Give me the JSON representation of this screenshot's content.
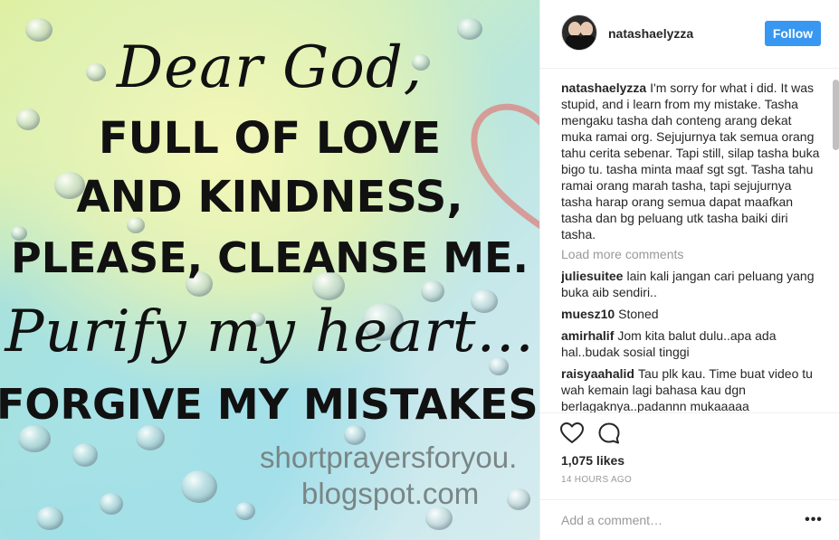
{
  "image": {
    "lines": [
      "Dear God,",
      "FULL OF LOVE",
      "AND KINDNESS,",
      "PLEASE,  CLEANSE ME.",
      "Purify my heart...",
      "FORGIVE MY MISTAKES..."
    ],
    "site_line1": "shortprayersforyou.",
    "site_line2": "blogspot.com"
  },
  "header": {
    "username": "natashaelyzza",
    "follow_label": "Follow"
  },
  "caption": {
    "user": "natashaelyzza",
    "text": "I'm sorry for what i did. It was stupid, and i learn from my mistake. Tasha mengaku tasha dah conteng arang dekat muka ramai org. Sejujurnya tak semua orang tahu cerita sebenar. Tapi still, silap tasha buka bigo tu. tasha minta maaf sgt sgt. Tasha tahu ramai orang marah tasha, tapi sejujurnya tasha harap orang semua dapat maafkan tasha dan bg peluang utk tasha baiki diri tasha."
  },
  "load_more": "Load more comments",
  "comments": [
    {
      "user": "juliesuitee",
      "text": "lain kali jangan cari peluang yang buka aib sendiri.."
    },
    {
      "user": "muesz10",
      "text": "Stoned"
    },
    {
      "user": "amirhalif",
      "text": "Jom kita balut dulu..apa ada hal..budak sosial tinggi"
    },
    {
      "user": "raisyaahalid",
      "text": "Tau plk kau. Time buat video tu wah kemain lagi bahasa kau dgn berlagaknya..padannn mukaaaaa"
    }
  ],
  "likes": "1,075 likes",
  "time": "14 HOURS AGO",
  "add_comment_placeholder": "Add a comment…",
  "more_label": "•••",
  "icons": [
    "heart-outline-icon",
    "comment-bubble-icon",
    "more-options-icon"
  ]
}
